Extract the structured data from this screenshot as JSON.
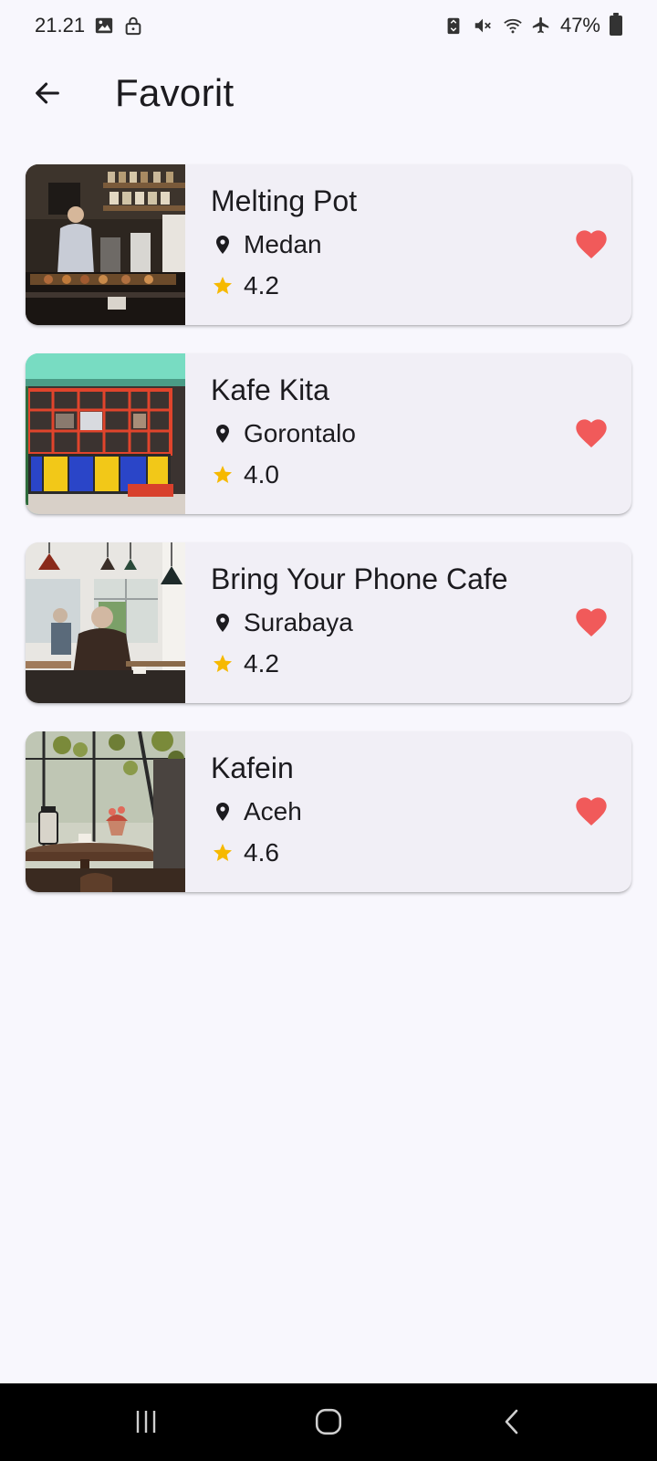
{
  "status_bar": {
    "time": "21.21",
    "battery": "47%"
  },
  "app_bar": {
    "title": "Favorit",
    "back_icon": "arrow-left-icon"
  },
  "favorites": [
    {
      "name": "Melting Pot",
      "city": "Medan",
      "rating": "4.2"
    },
    {
      "name": "Kafe Kita",
      "city": "Gorontalo",
      "rating": "4.0"
    },
    {
      "name": "Bring Your Phone Cafe",
      "city": "Surabaya",
      "rating": "4.2"
    },
    {
      "name": "Kafein",
      "city": "Aceh",
      "rating": "4.6"
    }
  ],
  "icons": {
    "city": "location-pin-icon",
    "rating": "star-icon",
    "favorite": "heart-icon"
  },
  "colors": {
    "background": "#f8f7fd",
    "card": "#f1eff6",
    "heart": "#f15a5a",
    "star": "#f6b900"
  },
  "nav_bar": {
    "buttons": [
      "recents-icon",
      "home-icon",
      "back-icon"
    ]
  }
}
